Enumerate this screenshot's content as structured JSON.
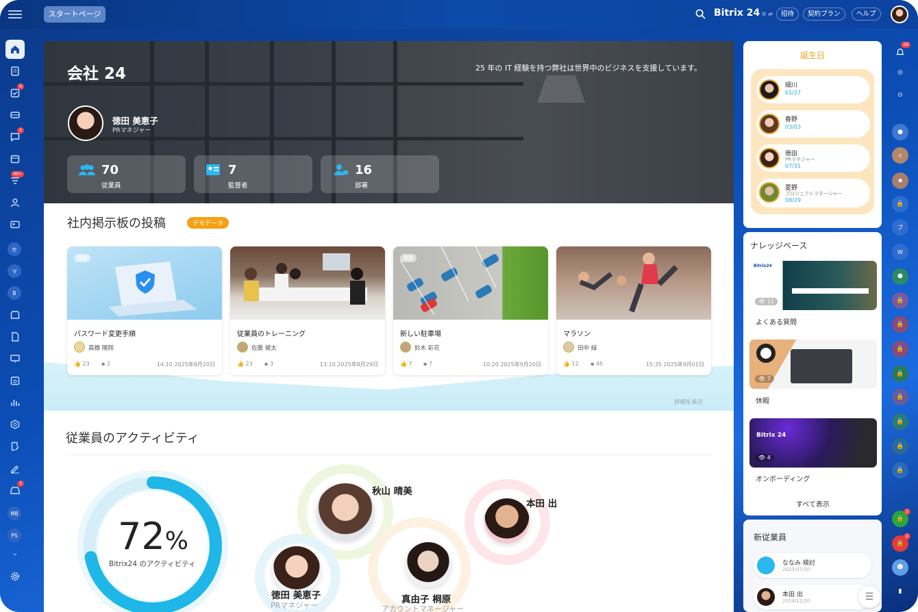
{
  "topbar": {
    "start_page": "スタートページ",
    "brand": "Bitrix 24",
    "brand_mark": "©",
    "invite": "招待",
    "plan": "契約プラン",
    "help": "ヘルプ"
  },
  "leftnav": {
    "badges": {
      "tasks": "9",
      "chat": "4",
      "feed": "99+",
      "store": "3"
    },
    "circles": [
      "セ",
      "マ",
      "B",
      "MB",
      "PS"
    ]
  },
  "hero": {
    "company": "会社 24",
    "tagline": "25 年の IT 経験を持つ弊社は世界中のビジネスを支援しています。",
    "person_name": "徳田 美恵子",
    "person_role": "PRマネジャー",
    "stats": [
      {
        "value": "70",
        "label": "従業員",
        "icon": "users-icon"
      },
      {
        "value": "7",
        "label": "監督者",
        "icon": "id-card-icon"
      },
      {
        "value": "16",
        "label": "部署",
        "icon": "department-icon"
      }
    ]
  },
  "board": {
    "title": "社内掲示板の投稿",
    "demo_badge": "デモデータ",
    "more": "詳細を表示",
    "posts": [
      {
        "tag": "重要",
        "title": "パスワード変更手順",
        "author": "高橋 陽翔",
        "likes": "23",
        "comments": "2",
        "date": "14:10 2025年8月20日"
      },
      {
        "tag": "",
        "title": "従業員のトレーニング",
        "author": "佐藤 健太",
        "likes": "23",
        "comments": "3",
        "date": "13:10 2025年8月29日"
      },
      {
        "tag": "重要",
        "title": "新しい駐車場",
        "author": "鈴木 彩花",
        "likes": "7",
        "comments": "7",
        "date": "10:20 2025年9月20日"
      },
      {
        "tag": "",
        "title": "マラソン",
        "author": "田中 緑",
        "likes": "12",
        "comments": "45",
        "date": "15:35 2025年9月01日"
      }
    ]
  },
  "activity": {
    "title": "従業員のアクティビティ",
    "percent": "72",
    "percent_sign": "%",
    "percent_value": 0.72,
    "percent_label": "Bitrix24 のアクティビティ",
    "people": [
      {
        "name": "秋山 晴美",
        "role": ""
      },
      {
        "name": "本田 出",
        "role": ""
      },
      {
        "name": "徳田 美恵子",
        "role": "PRマネジャー"
      },
      {
        "name": "真由子 桐原",
        "role": "アカウントマネージャー"
      }
    ]
  },
  "birthdays": {
    "title": "誕生日",
    "items": [
      {
        "name": "細川",
        "role": "",
        "date": "01/27"
      },
      {
        "name": "春野",
        "role": "",
        "date": "03/03"
      },
      {
        "name": "徳田",
        "role": "PRマネジャー",
        "date": "07/31"
      },
      {
        "name": "夏野",
        "role": "プロジェクトマネージャー",
        "date": "08/29"
      }
    ]
  },
  "knowledge": {
    "title": "ナレッジベース",
    "items": [
      {
        "label": "よくある質問",
        "views": "11",
        "brand": "Bitrix24"
      },
      {
        "label": "休暇",
        "views": "7",
        "brand": ""
      },
      {
        "label": "オンボーディング",
        "views": "4",
        "brand": "Bitrix 24"
      }
    ],
    "show_all": "すべて表示"
  },
  "new_employees": {
    "title": "新従業員",
    "items": [
      {
        "name": "ななみ 検討",
        "date": "2025/07/30"
      },
      {
        "name": "本田 出",
        "date": "2024/12/20"
      }
    ]
  },
  "rightbar": {
    "notif_badge": "28",
    "lock_badge_1": "2",
    "lock_badge_2": "2",
    "letters": [
      "イ",
      "ブ",
      "W"
    ]
  },
  "colors": {
    "accent": "#1fb6e8",
    "brand": "#0c4aa8",
    "demo": "#f6a012",
    "badge": "#f0424a",
    "bday": "#fde6bf"
  }
}
